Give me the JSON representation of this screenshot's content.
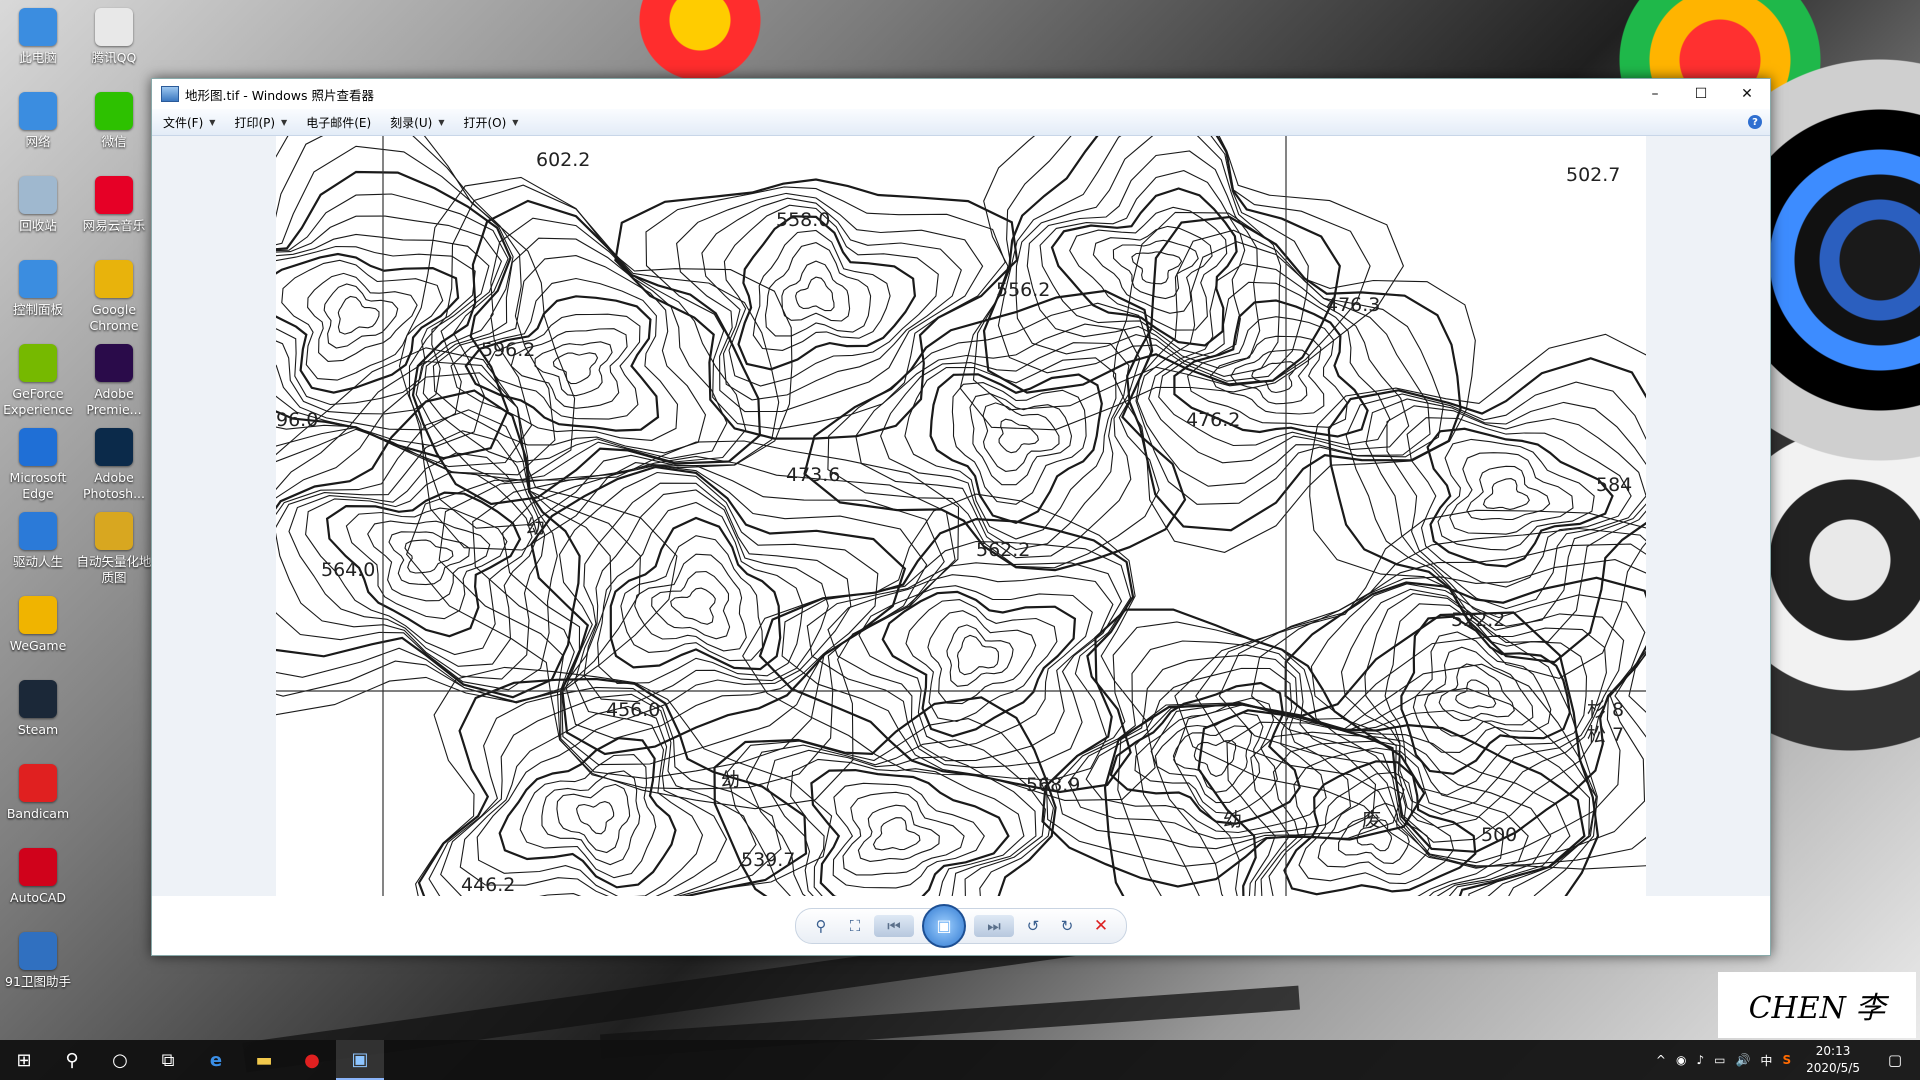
{
  "desktop": {
    "icons": [
      {
        "label": "此电脑",
        "icon": "computer-icon",
        "color": "#3b8de0"
      },
      {
        "label": "腾讯QQ",
        "icon": "qq-icon",
        "color": "#e8e8e8"
      },
      {
        "label": "网络",
        "icon": "network-icon",
        "color": "#3b8de0"
      },
      {
        "label": "微信",
        "icon": "wechat-icon",
        "color": "#2dc100"
      },
      {
        "label": "回收站",
        "icon": "recycle-bin-icon",
        "color": "#9fb8cf"
      },
      {
        "label": "网易云音乐",
        "icon": "netease-music-icon",
        "color": "#e60026"
      },
      {
        "label": "控制面板",
        "icon": "control-panel-icon",
        "color": "#3b8de0"
      },
      {
        "label": "Google Chrome",
        "icon": "chrome-icon",
        "color": "#e8b30c"
      },
      {
        "label": "GeForce Experience",
        "icon": "geforce-icon",
        "color": "#76b900"
      },
      {
        "label": "Adobe Premie...",
        "icon": "premiere-icon",
        "color": "#2a0b4a"
      },
      {
        "label": "Microsoft Edge",
        "icon": "edge-icon",
        "color": "#1f6fd6"
      },
      {
        "label": "Adobe Photosh...",
        "icon": "photoshop-icon",
        "color": "#0b2a4a"
      },
      {
        "label": "驱动人生",
        "icon": "driver-icon",
        "color": "#2b7ad8"
      },
      {
        "label": "自动矢量化地质图",
        "icon": "vector-map-icon",
        "color": "#d8a720"
      },
      {
        "label": "WeGame",
        "icon": "wegame-icon",
        "color": "#f0b400"
      },
      {
        "label": "Steam",
        "icon": "steam-icon",
        "color": "#1b2838"
      },
      {
        "label": "Bandicam",
        "icon": "bandicam-icon",
        "color": "#e02020"
      },
      {
        "label": "AutoCAD",
        "icon": "autocad-icon",
        "color": "#d0021b"
      },
      {
        "label": "91卫图助手",
        "icon": "satellite-map-icon",
        "color": "#3070c0"
      }
    ]
  },
  "window": {
    "title": "地形图.tif - Windows 照片查看器",
    "menus": [
      {
        "label": "文件(F)",
        "has_caret": true
      },
      {
        "label": "打印(P)",
        "has_caret": true
      },
      {
        "label": "电子邮件(E)",
        "has_caret": false
      },
      {
        "label": "刻录(U)",
        "has_caret": true
      },
      {
        "label": "打开(O)",
        "has_caret": true
      }
    ],
    "help": "?",
    "controls": {
      "minimize": "–",
      "maximize": "☐",
      "close": "✕"
    }
  },
  "map": {
    "elevation_labels": [
      "602.2",
      "502.7",
      "558.0",
      "556.2",
      "476.3",
      "596.2",
      "96.0",
      "476.2",
      "473.6",
      "584",
      "562.2",
      "564.0",
      "522.2",
      "456.0",
      "杉 8",
      "松 7",
      "568.9",
      "539.7",
      "500",
      "446.2",
      "幼",
      "幼",
      "幼",
      "废"
    ]
  },
  "toolbar": {
    "zoom": "⚲",
    "fit": "⛶",
    "prev": "⏮",
    "slideshow": "▣",
    "next": "⏭",
    "rotate_left": "↺",
    "rotate_right": "↻",
    "delete": "✕"
  },
  "taskbar": {
    "clock_time": "20:13",
    "clock_date": "2020/5/5",
    "ime": "中",
    "tray_symbols": [
      "^",
      "◉",
      "♪",
      "▭",
      "🔊",
      "中",
      "S"
    ]
  },
  "signature_text": "CHEN 李"
}
